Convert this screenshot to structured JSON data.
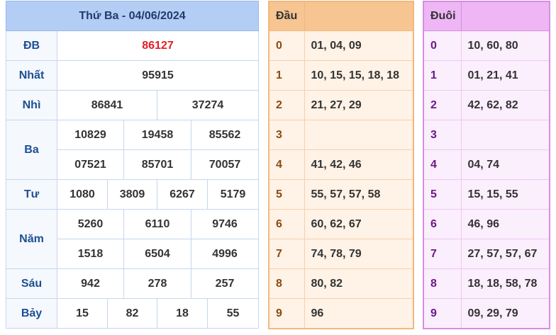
{
  "results": {
    "title": "Thứ Ba - 04/06/2024",
    "prizes": {
      "db": {
        "label": "ĐB",
        "values": [
          "86127"
        ]
      },
      "nhat": {
        "label": "Nhất",
        "values": [
          "95915"
        ]
      },
      "nhi": {
        "label": "Nhì",
        "values": [
          "86841",
          "37274"
        ]
      },
      "ba": {
        "label": "Ba",
        "values": [
          "10829",
          "19458",
          "85562",
          "07521",
          "85701",
          "70057"
        ]
      },
      "tu": {
        "label": "Tư",
        "values": [
          "1080",
          "3809",
          "6267",
          "5179"
        ]
      },
      "nam": {
        "label": "Năm",
        "values": [
          "5260",
          "6110",
          "9746",
          "1518",
          "6504",
          "4996"
        ]
      },
      "sau": {
        "label": "Sáu",
        "values": [
          "942",
          "278",
          "257"
        ]
      },
      "bay": {
        "label": "Bảy",
        "values": [
          "15",
          "82",
          "18",
          "55"
        ]
      }
    },
    "special_color": "#e51c23"
  },
  "head": {
    "title": "Đầu",
    "rows": [
      {
        "digit": "0",
        "values": "01, 04, 09"
      },
      {
        "digit": "1",
        "values": "10, 15, 15, 18, 18"
      },
      {
        "digit": "2",
        "values": "21, 27, 29"
      },
      {
        "digit": "3",
        "values": ""
      },
      {
        "digit": "4",
        "values": "41, 42, 46"
      },
      {
        "digit": "5",
        "values": "55, 57, 57, 58"
      },
      {
        "digit": "6",
        "values": "60, 62, 67"
      },
      {
        "digit": "7",
        "values": "74, 78, 79"
      },
      {
        "digit": "8",
        "values": "80, 82"
      },
      {
        "digit": "9",
        "values": "96"
      }
    ]
  },
  "tail": {
    "title": "Đuôi",
    "rows": [
      {
        "digit": "0",
        "values": "10, 60, 80"
      },
      {
        "digit": "1",
        "values": "01, 21, 41"
      },
      {
        "digit": "2",
        "values": "42, 62, 82"
      },
      {
        "digit": "3",
        "values": ""
      },
      {
        "digit": "4",
        "values": "04, 74"
      },
      {
        "digit": "5",
        "values": "15, 15, 55"
      },
      {
        "digit": "6",
        "values": "46, 96"
      },
      {
        "digit": "7",
        "values": "27, 57, 57, 67"
      },
      {
        "digit": "8",
        "values": "18, 18, 58, 78"
      },
      {
        "digit": "9",
        "values": "09, 29, 79"
      }
    ]
  }
}
